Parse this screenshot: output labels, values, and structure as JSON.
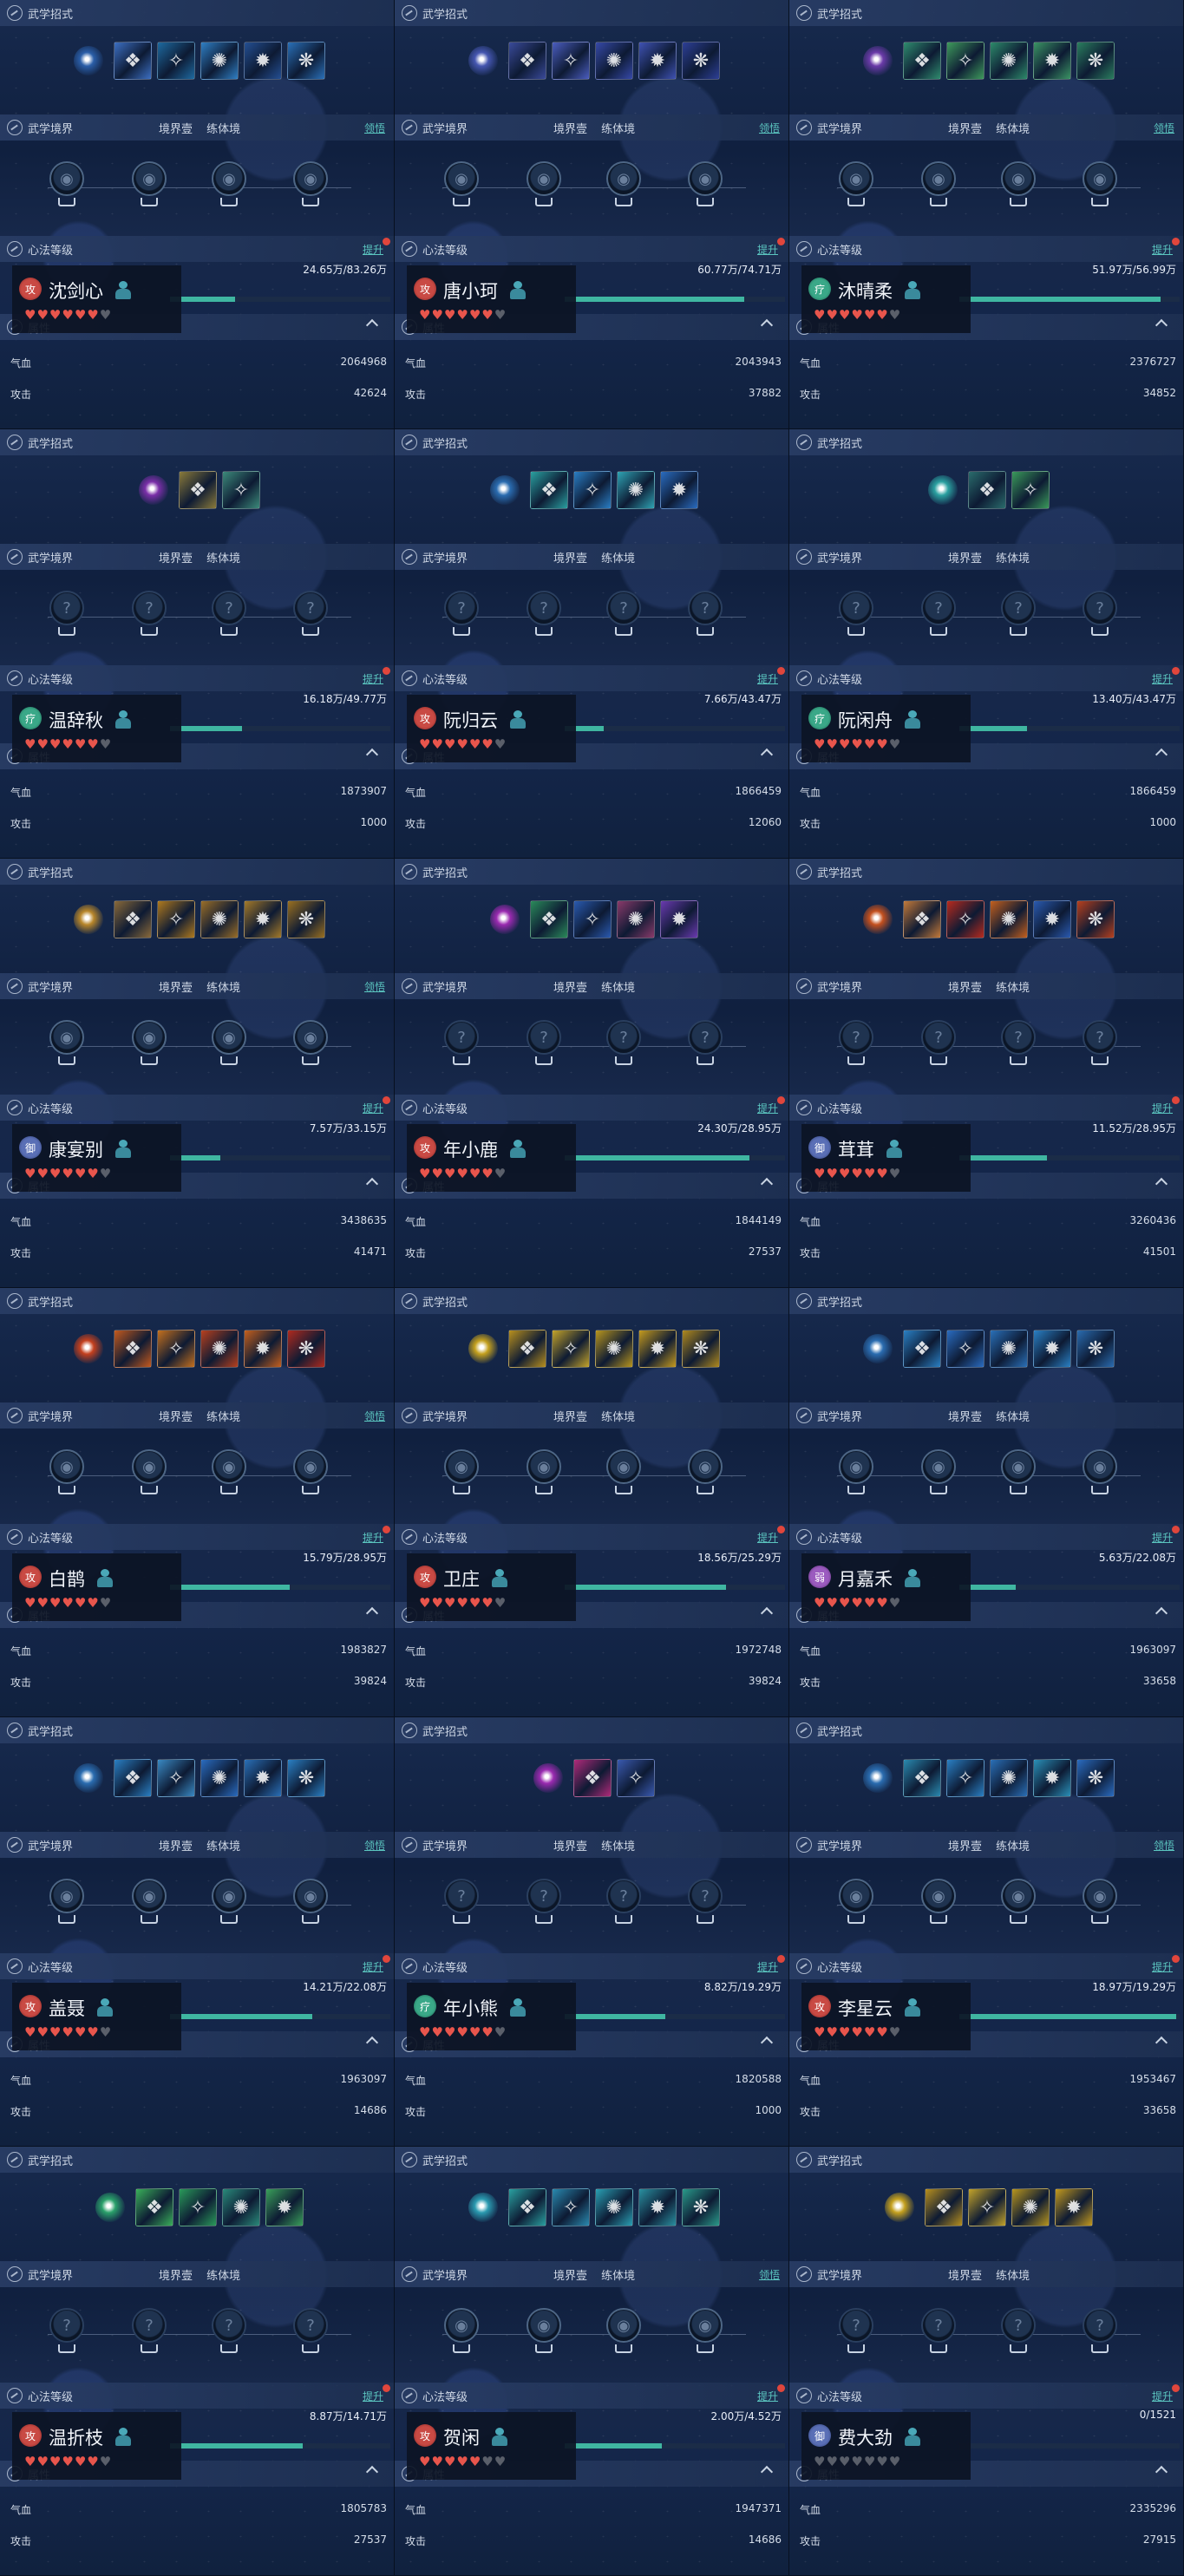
{
  "labels": {
    "skills": "武学招式",
    "realm": "武学境界",
    "realm_tab1": "境界壹",
    "realm_tab2": "练体境",
    "realm_link": "领悟",
    "level": "心法等级",
    "upgrade": "提升",
    "attrs": "属性",
    "hp": "气血",
    "atk": "攻击"
  },
  "colors": {
    "xp_fill": "#3fb6a1",
    "link": "#5bc6c0",
    "heart_on": "#e8554c",
    "heart_off": "#5a5f6a",
    "notify_dot": "#e0463c"
  },
  "cards": [
    {
      "name": "沈剑心",
      "badge": "攻",
      "badge_color": "r",
      "xp": "24.65万/83.26万",
      "xp_fraction": 0.296,
      "hearts": 6,
      "hp": "2064968",
      "atk": "42624",
      "realm_link": true,
      "level_dot": true,
      "skills": 6,
      "skill_palette": [
        "#2a5ea8",
        "#3c6fc2",
        "#1e6aa0",
        "#2f7fc4",
        "#244f93",
        "#2a70b8"
      ],
      "has_sig": true,
      "realm_lit": true
    },
    {
      "name": "唐小珂",
      "badge": "攻",
      "badge_color": "r",
      "xp": "60.77万/74.71万",
      "xp_fraction": 0.813,
      "hearts": 6,
      "hp": "2043943",
      "atk": "37882",
      "realm_link": true,
      "level_dot": true,
      "skills": 6,
      "skill_palette": [
        "#4556b0",
        "#3a4a9a",
        "#4b5dbf",
        "#3649a8",
        "#3f52b3",
        "#2d3f96"
      ],
      "has_sig": true,
      "realm_lit": true
    },
    {
      "name": "沐晴柔",
      "badge": "疗",
      "badge_color": "g",
      "xp": "51.97万/56.99万",
      "xp_fraction": 0.912,
      "hearts": 6,
      "hp": "2376727",
      "atk": "34852",
      "realm_link": true,
      "level_dot": true,
      "skills": 6,
      "skill_palette": [
        "#6a3aa8",
        "#2f8c6e",
        "#3e9a5c",
        "#2d8a6a",
        "#3b9464",
        "#2a7e5e"
      ],
      "has_sig": true,
      "realm_lit": true
    },
    {
      "name": "温辞秋",
      "badge": "疗",
      "badge_color": "g",
      "xp": "16.18万/49.77万",
      "xp_fraction": 0.325,
      "hearts": 6,
      "hp": "1873907",
      "atk": "1000",
      "realm_link": false,
      "level_dot": true,
      "skills": 3,
      "skill_palette": [
        "#7a2fa8",
        "#8a7a3a",
        "#3c8a7a"
      ],
      "has_sig": true,
      "realm_lit": false
    },
    {
      "name": "阮归云",
      "badge": "攻",
      "badge_color": "r",
      "xp": "7.66万/43.47万",
      "xp_fraction": 0.176,
      "hearts": 6,
      "hp": "1866459",
      "atk": "12060",
      "realm_link": false,
      "level_dot": true,
      "skills": 5,
      "skill_palette": [
        "#2a6cb0",
        "#2aa0a0",
        "#2a7ec4",
        "#2fa4b4",
        "#2a6cc0"
      ],
      "has_sig": true,
      "realm_lit": false
    },
    {
      "name": "阮闲舟",
      "badge": "疗",
      "badge_color": "g",
      "xp": "13.40万/43.47万",
      "xp_fraction": 0.308,
      "hearts": 6,
      "hp": "1866459",
      "atk": "1000",
      "realm_link": false,
      "level_dot": true,
      "skills": 3,
      "skill_palette": [
        "#2aa0a0",
        "#2a6c6c",
        "#3a9a5a"
      ],
      "has_sig": true,
      "realm_lit": false
    },
    {
      "name": "康宴别",
      "badge": "御",
      "badge_color": "b",
      "xp": "7.57万/33.15万",
      "xp_fraction": 0.228,
      "hearts": 6,
      "hp": "3438635",
      "atk": "41471",
      "realm_link": true,
      "level_dot": true,
      "skills": 6,
      "skill_palette": [
        "#b8862a",
        "#8a6a3a",
        "#b07a1e",
        "#9a6e28",
        "#a47a2a",
        "#9a7020"
      ],
      "has_sig": true,
      "realm_lit": true
    },
    {
      "name": "年小鹿",
      "badge": "攻",
      "badge_color": "r",
      "xp": "24.30万/28.95万",
      "xp_fraction": 0.839,
      "hearts": 6,
      "hp": "1844149",
      "atk": "27537",
      "realm_link": false,
      "level_dot": true,
      "skills": 5,
      "skill_palette": [
        "#9a2ab0",
        "#2a8a5a",
        "#2a5ab0",
        "#8a3a6a",
        "#6a3ab0"
      ],
      "has_sig": true,
      "realm_lit": false
    },
    {
      "name": "茸茸",
      "badge": "御",
      "badge_color": "b",
      "xp": "11.52万/28.95万",
      "xp_fraction": 0.398,
      "hearts": 6,
      "hp": "3260436",
      "atk": "41501",
      "realm_link": false,
      "level_dot": true,
      "skills": 6,
      "skill_palette": [
        "#c4501e",
        "#c47a3a",
        "#b82a1e",
        "#c4601e",
        "#2a5ab0",
        "#b8401e"
      ],
      "has_sig": true,
      "realm_lit": false
    },
    {
      "name": "白鹊",
      "badge": "攻",
      "badge_color": "r",
      "xp": "15.79万/28.95万",
      "xp_fraction": 0.545,
      "hearts": 6,
      "hp": "1983827",
      "atk": "39824",
      "realm_link": true,
      "level_dot": true,
      "skills": 6,
      "skill_palette": [
        "#c4401e",
        "#c45a1e",
        "#c4701e",
        "#b8401e",
        "#c4601e",
        "#b02a1e"
      ],
      "has_sig": true,
      "realm_lit": true
    },
    {
      "name": "卫庄",
      "badge": "攻",
      "badge_color": "r",
      "xp": "18.56万/25.29万",
      "xp_fraction": 0.734,
      "hearts": 6,
      "hp": "1972748",
      "atk": "39824",
      "realm_link": false,
      "level_dot": true,
      "skills": 6,
      "skill_palette": [
        "#c4a01e",
        "#b8901e",
        "#c4a42a",
        "#b8961e",
        "#c49a1e",
        "#b08a1e"
      ],
      "has_sig": true,
      "realm_lit": true
    },
    {
      "name": "月嘉禾",
      "badge": "弱",
      "badge_color": "p",
      "xp": "5.63万/22.08万",
      "xp_fraction": 0.255,
      "hearts": 6,
      "hp": "1963097",
      "atk": "33658",
      "realm_link": false,
      "level_dot": true,
      "skills": 6,
      "skill_palette": [
        "#2a6cb0",
        "#2a80c4",
        "#2a6cc0",
        "#2a70b8",
        "#2a80c4",
        "#2a6cb0"
      ],
      "has_sig": true,
      "realm_lit": true
    },
    {
      "name": "盖聂",
      "badge": "攻",
      "badge_color": "r",
      "xp": "14.21万/22.08万",
      "xp_fraction": 0.644,
      "hearts": 6,
      "hp": "1963097",
      "atk": "14686",
      "realm_link": true,
      "level_dot": true,
      "skills": 6,
      "skill_palette": [
        "#2a6cb0",
        "#2a80c4",
        "#3a8ac4",
        "#2a6cc0",
        "#2a70b8",
        "#2a80c4"
      ],
      "has_sig": true,
      "realm_lit": true
    },
    {
      "name": "年小熊",
      "badge": "疗",
      "badge_color": "g",
      "xp": "8.82万/19.29万",
      "xp_fraction": 0.457,
      "hearts": 6,
      "hp": "1820588",
      "atk": "1000",
      "realm_link": false,
      "level_dot": true,
      "skills": 3,
      "skill_palette": [
        "#9a2ab0",
        "#b02a7a",
        "#3a5ab0"
      ],
      "has_sig": true,
      "realm_lit": false
    },
    {
      "name": "李星云",
      "badge": "攻",
      "badge_color": "r",
      "xp": "18.97万/19.29万",
      "xp_fraction": 0.983,
      "hearts": 6,
      "hp": "1953467",
      "atk": "33658",
      "realm_link": true,
      "level_dot": true,
      "skills": 6,
      "skill_palette": [
        "#2a6cb0",
        "#2a8ab0",
        "#2a80c4",
        "#2a70b8",
        "#2a90b8",
        "#2a6cc0"
      ],
      "has_sig": true,
      "realm_lit": true
    },
    {
      "name": "温折枝",
      "badge": "攻",
      "badge_color": "r",
      "xp": "8.87万/14.71万",
      "xp_fraction": 0.603,
      "hearts": 6,
      "hp": "1805783",
      "atk": "27537",
      "realm_link": false,
      "level_dot": true,
      "skills": 5,
      "skill_palette": [
        "#2aa06a",
        "#3ab05a",
        "#2a9a5a",
        "#2a8a7a",
        "#3aa05a"
      ],
      "has_sig": true,
      "realm_lit": false
    },
    {
      "name": "贺闲",
      "badge": "攻",
      "badge_color": "r",
      "xp": "2.00万/4.52万",
      "xp_fraction": 0.442,
      "hearts": 5,
      "hp": "1947371",
      "atk": "14686",
      "realm_link": true,
      "level_dot": true,
      "skills": 6,
      "skill_palette": [
        "#2a9ab0",
        "#2aa0a0",
        "#2a8ab0",
        "#2aa0b4",
        "#2a90a0",
        "#2a9a8a"
      ],
      "has_sig": true,
      "realm_lit": true
    },
    {
      "name": "费大劲",
      "badge": "御",
      "badge_color": "b",
      "xp": "0/1521",
      "xp_fraction": 0.0,
      "hearts": 0,
      "hp": "2335296",
      "atk": "27915",
      "realm_link": false,
      "level_dot": true,
      "skills": 5,
      "skill_palette": [
        "#c4a01e",
        "#b8901e",
        "#c4a42a",
        "#b8961e",
        "#c49a1e"
      ],
      "has_sig": true,
      "realm_lit": false
    }
  ]
}
